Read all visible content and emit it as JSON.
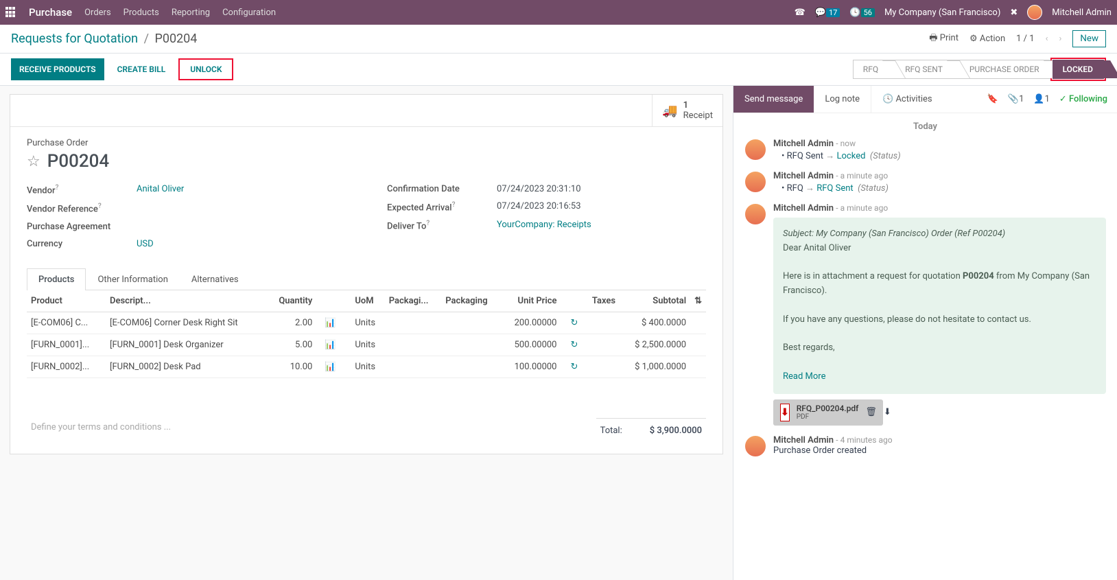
{
  "topbar": {
    "app": "Purchase",
    "menu": [
      "Orders",
      "Products",
      "Reporting",
      "Configuration"
    ],
    "msg_count": "17",
    "activity_count": "56",
    "company": "My Company (San Francisco)",
    "user": "Mitchell Admin"
  },
  "cp": {
    "crumb_root": "Requests for Quotation",
    "crumb_current": "P00204",
    "print": "Print",
    "action": "Action",
    "pager": "1 / 1",
    "new": "New"
  },
  "buttons": {
    "receive": "RECEIVE PRODUCTS",
    "create_bill": "CREATE BILL",
    "unlock": "UNLOCK"
  },
  "status": {
    "steps": [
      "RFQ",
      "RFQ SENT",
      "PURCHASE ORDER",
      "LOCKED"
    ]
  },
  "statbox": {
    "count": "1",
    "label": "Receipt"
  },
  "form": {
    "label": "Purchase Order",
    "name": "P00204",
    "vendor_label": "Vendor",
    "vendor": "Anital Oliver",
    "vendor_ref_label": "Vendor Reference",
    "agreement_label": "Purchase Agreement",
    "currency_label": "Currency",
    "currency": "USD",
    "confirm_label": "Confirmation Date",
    "confirm": "07/24/2023 20:31:10",
    "arrival_label": "Expected Arrival",
    "arrival": "07/24/2023 20:16:53",
    "deliver_label": "Deliver To",
    "deliver": "YourCompany: Receipts"
  },
  "tabs": [
    "Products",
    "Other Information",
    "Alternatives"
  ],
  "thead": {
    "product": "Product",
    "desc": "Descript...",
    "qty": "Quantity",
    "uom": "UoM",
    "pkgi": "Packagi...",
    "pkg": "Packaging",
    "price": "Unit Price",
    "taxes": "Taxes",
    "subtotal": "Subtotal"
  },
  "lines": [
    {
      "product": "[E-COM06] C...",
      "desc": "[E-COM06] Corner Desk Right Sit",
      "qty": "2.00",
      "uom": "Units",
      "price": "200.00000",
      "subtotal": "$ 400.0000"
    },
    {
      "product": "[FURN_0001]...",
      "desc": "[FURN_0001] Desk Organizer",
      "qty": "5.00",
      "uom": "Units",
      "price": "500.00000",
      "subtotal": "$ 2,500.0000"
    },
    {
      "product": "[FURN_0002]...",
      "desc": "[FURN_0002] Desk Pad",
      "qty": "10.00",
      "uom": "Units",
      "price": "100.00000",
      "subtotal": "$ 1,000.0000"
    }
  ],
  "terms_placeholder": "Define your terms and conditions ...",
  "totals": {
    "total_label": "Total:",
    "total": "$ 3,900.0000"
  },
  "chatter": {
    "send": "Send message",
    "lognote": "Log note",
    "activities": "Activities",
    "attach_count": "1",
    "follower_count": "1",
    "following": "Following",
    "today": "Today",
    "m1": {
      "author": "Mitchell Admin",
      "time": "now",
      "from": "RFQ Sent",
      "to": "Locked",
      "field": "(Status)"
    },
    "m2": {
      "author": "Mitchell Admin",
      "time": "a minute ago",
      "from": "RFQ",
      "to": "RFQ Sent",
      "field": "(Status)"
    },
    "m3": {
      "author": "Mitchell Admin",
      "time": "a minute ago",
      "subject": "Subject: My Company (San Francisco) Order (Ref P00204)",
      "greet": "Dear Anital Oliver",
      "body1a": "Here is in attachment a request for quotation ",
      "body1b": "P00204",
      "body1c": " from My Company (San Francisco).",
      "body2": "If you have any questions, please do not hesitate to contact us.",
      "body3": "Best regards,",
      "readmore": "Read More",
      "attachment": "RFQ_P00204.pdf",
      "attach_type": "PDF"
    },
    "m4": {
      "author": "Mitchell Admin",
      "time": "4 minutes ago",
      "body": "Purchase Order created"
    }
  }
}
